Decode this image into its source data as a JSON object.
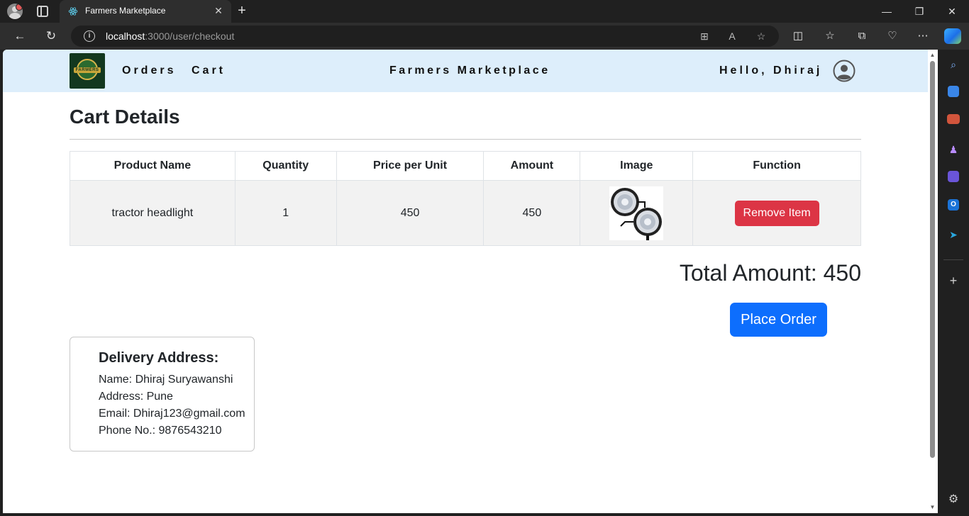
{
  "browser": {
    "tab_title": "Farmers Marketplace",
    "url_host": "localhost",
    "url_rest": ":3000/user/checkout"
  },
  "navbar": {
    "logo_text": "FARMERS",
    "links": [
      "Orders",
      "Cart"
    ],
    "brand": "Farmers Marketplace",
    "greeting": "Hello, Dhiraj"
  },
  "page": {
    "title": "Cart Details"
  },
  "cart": {
    "columns": [
      "Product Name",
      "Quantity",
      "Price per Unit",
      "Amount",
      "Image",
      "Function"
    ],
    "rows": [
      {
        "product_name": "tractor headlight",
        "quantity": "1",
        "price_per_unit": "450",
        "amount": "450",
        "image": "tractor-headlight-image",
        "action_label": "Remove Item"
      }
    ]
  },
  "summary": {
    "total_label": "Total Amount: 450",
    "place_order_label": "Place Order"
  },
  "delivery": {
    "title": "Delivery Address:",
    "name": "Name: Dhiraj Suryawanshi",
    "address": "Address: Pune",
    "email": "Email: Dhiraj123@gmail.com",
    "phone": "Phone No.: 9876543210"
  },
  "colors": {
    "navbar_bg": "#ddeefb",
    "danger": "#dc3545",
    "primary": "#0d6efd"
  }
}
